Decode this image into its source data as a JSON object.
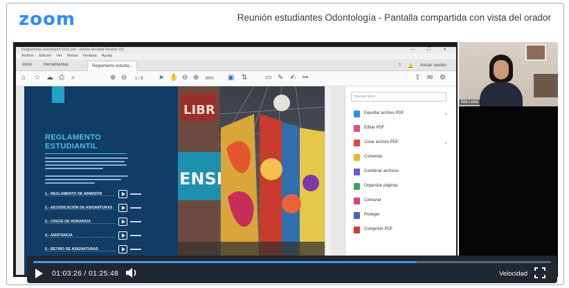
{
  "zoom": {
    "logo": "zoom",
    "meeting_title": "Reunión estudiantes Odontología - Pantalla compartida con vista del orador"
  },
  "pdf": {
    "window_title": "Reglamento estudiantil 2022.pdf - Adobe Acrobat Reader DC",
    "menu": [
      "Archivo",
      "Edición",
      "Ver",
      "Firmar",
      "Ventana",
      "Ayuda"
    ],
    "tabs": [
      "Inicio",
      "Herramientas",
      "Reglamento estudia..."
    ],
    "signin": "Iniciar sesión",
    "page_indicator": "1 / 8",
    "zoom_level": "86%",
    "document": {
      "heading_line1": "REGLAMENTO",
      "heading_line2": "ESTUDIANTIL",
      "index": [
        "1.- REGLAMENTO DE ADMISIÓN",
        "2.- ADJUDICACIÓN DE ASIGNATURAS",
        "3.- CRUCE DE HORARIOS",
        "4.- ASISTENCIA",
        "5.- RETIRO DE ASIGNATURAS"
      ],
      "mural_text": "ENSE"
    },
    "tools": {
      "search_placeholder": "Buscar tipos",
      "items": [
        {
          "label": "Exportar archivo PDF",
          "color": "#2f8ee0",
          "chevron": true
        },
        {
          "label": "Editar PDF",
          "color": "#e04d8b",
          "chevron": false
        },
        {
          "label": "Crear archivo PDF",
          "color": "#e0473a",
          "chevron": true
        },
        {
          "label": "Comentar",
          "color": "#f1b52b",
          "chevron": false
        },
        {
          "label": "Combinar archivos",
          "color": "#6a5bd6",
          "chevron": false
        },
        {
          "label": "Organizar páginas",
          "color": "#39a85c",
          "chevron": false
        },
        {
          "label": "Censurar",
          "color": "#d9476f",
          "chevron": false
        },
        {
          "label": "Proteger",
          "color": "#4a5fc8",
          "chevron": false
        },
        {
          "label": "Comprimir PDF",
          "color": "#d13b3b",
          "chevron": false
        }
      ]
    }
  },
  "speaker": {
    "name": "ilda Leda"
  },
  "player": {
    "current_time": "01:03:26",
    "total_time": "01:25:48",
    "progress": 0.74,
    "speed_label": "Velocidad"
  }
}
